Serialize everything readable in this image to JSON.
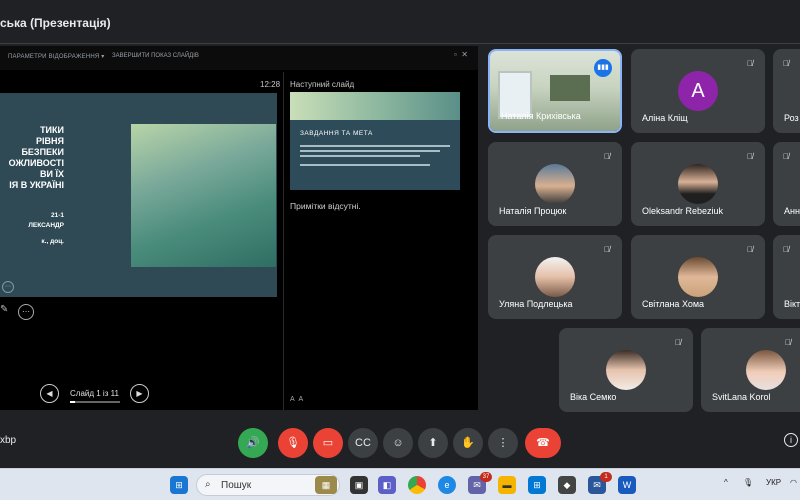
{
  "window": {
    "title": "ська (Презентація)"
  },
  "presenter": {
    "toolbar": {
      "display_settings": "ПАРАМЕТРИ ВІДОБРАЖЕННЯ ▾",
      "end_show": "ЗАВЕРШИТИ ПОКАЗ СЛАЙДІВ"
    },
    "time": "12:28",
    "current_slide": {
      "title_lines": [
        "ТИКИ",
        "РІВНЯ",
        "БЕЗПЕКИ",
        "ОЖЛИВОСТІ",
        "ВИ ЇХ",
        "ІЯ В УКРАЇНІ"
      ],
      "meta_lines": [
        "21-1",
        "ЛЕКСАНДР",
        "к., доц."
      ]
    },
    "next_slide": {
      "label": "Наступний слайд",
      "title": "ЗАВДАННЯ ТА МЕТА"
    },
    "notes": "Примітки відсутні.",
    "navigation": {
      "counter": "Слайд 1 із 11",
      "progress": 0.09
    }
  },
  "participants": [
    {
      "name": "Наталія Криxівська",
      "avatar_icon": "classroom-video",
      "speaking": true
    },
    {
      "name": "Аліна Кліщ",
      "initial": "A",
      "avatar_color": "#8e24aa",
      "muted": true
    },
    {
      "name": "Роз",
      "muted": true
    },
    {
      "name": "Наталія Процюк",
      "muted": true,
      "avatar_icon": "woman-photo"
    },
    {
      "name": "Oleksandr Rebeziuk",
      "muted": true,
      "avatar_icon": "man-photo"
    },
    {
      "name": "Анн",
      "muted": true
    },
    {
      "name": "Уляна Подлецька",
      "muted": true,
      "avatar_icon": "woman-photo"
    },
    {
      "name": "Світлана Хома",
      "muted": true,
      "avatar_icon": "woman-photo"
    },
    {
      "name": "Вікт",
      "muted": true
    },
    {
      "name": "Віка Семко",
      "muted": true,
      "avatar_icon": "woman-photo"
    },
    {
      "name": "SvitLana Korol",
      "muted": true,
      "avatar_icon": "woman-photo"
    }
  ],
  "controls": {
    "meeting_code": "xbp",
    "buttons": [
      "speaker-icon",
      "mic-off-icon",
      "camera-off-icon",
      "captions-icon",
      "emoji-icon",
      "present-icon",
      "raise-hand-icon",
      "more-icon",
      "end-call-icon"
    ],
    "colors": {
      "green": "#34a853",
      "red": "#ea4335",
      "dark": "#3c4043"
    }
  },
  "taskbar": {
    "search_placeholder": "Пошук",
    "badges": {
      "chat": "37",
      "mail": "1"
    },
    "language": "УКР"
  }
}
